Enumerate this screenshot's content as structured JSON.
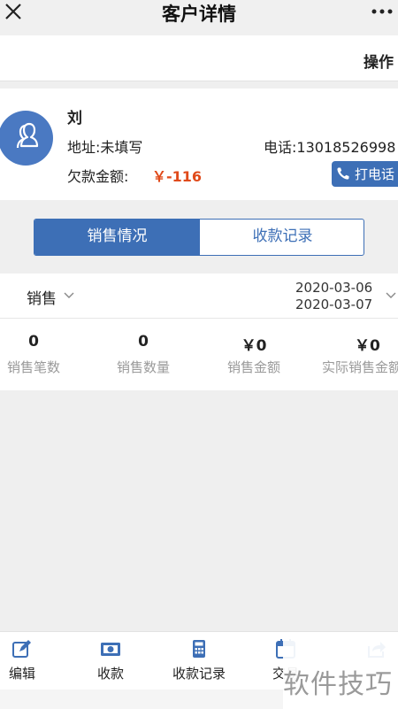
{
  "navbar": {
    "title": "客户详情"
  },
  "action_bar": {
    "label": "操作"
  },
  "customer": {
    "name": "刘",
    "address": "地址:未填写",
    "phone": "电话:13018526998",
    "debt_label": "欠款金额:",
    "debt_value": "￥-116",
    "call_button_label": "打电话"
  },
  "segment": {
    "tabs": [
      {
        "label": "销售情况",
        "active": true
      },
      {
        "label": "收款记录",
        "active": false
      }
    ]
  },
  "filter": {
    "type": "销售",
    "date_start": "2020-03-06",
    "date_end": "2020-03-07"
  },
  "stats": [
    {
      "value": "0",
      "label": "销售笔数"
    },
    {
      "value": "0",
      "label": "销售数量"
    },
    {
      "value": "￥0",
      "label": "销售金额"
    },
    {
      "value": "￥0",
      "label": "实际销售金额"
    }
  ],
  "tabbar": {
    "items": [
      {
        "label": "编辑",
        "icon": "edit-icon"
      },
      {
        "label": "收款",
        "icon": "cash-icon"
      },
      {
        "label": "收款记录",
        "icon": "calculator-icon"
      },
      {
        "label": "交易",
        "icon": "calendar-icon"
      },
      {
        "label": "",
        "icon": "share-icon"
      }
    ]
  },
  "watermark": "软件技巧",
  "colors": {
    "accent": "#3d6fb6",
    "debt": "#e04a1a",
    "avatar": "#4a79c2"
  }
}
